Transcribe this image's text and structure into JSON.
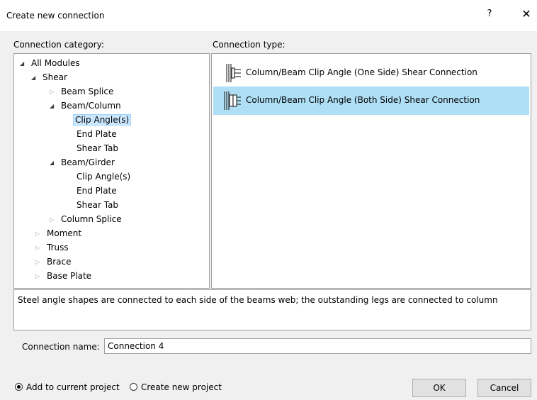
{
  "window": {
    "title": "Create new connection",
    "help_label": "?",
    "close_label": "✕"
  },
  "category": {
    "label": "Connection category:",
    "tree": [
      {
        "label": "All Modules",
        "caret": "◢",
        "expanded": true
      },
      {
        "label": "Shear",
        "caret": "◢",
        "expanded": true
      },
      {
        "label": "Beam Splice",
        "caret": "▷",
        "expanded": false
      },
      {
        "label": "Beam/Column",
        "caret": "◢",
        "expanded": true
      },
      {
        "label": "Clip Angle(s)",
        "caret": "",
        "selected": true
      },
      {
        "label": "End Plate",
        "caret": ""
      },
      {
        "label": "Shear Tab",
        "caret": ""
      },
      {
        "label": "Beam/Girder",
        "caret": "◢",
        "expanded": true
      },
      {
        "label": "Clip Angle(s)",
        "caret": ""
      },
      {
        "label": "End Plate",
        "caret": ""
      },
      {
        "label": "Shear Tab",
        "caret": ""
      },
      {
        "label": "Column Splice",
        "caret": "▷",
        "expanded": false
      },
      {
        "label": "Moment",
        "caret": "▷",
        "expanded": false
      },
      {
        "label": "Truss",
        "caret": "▷",
        "expanded": false
      },
      {
        "label": "Brace",
        "caret": "▷",
        "expanded": false
      },
      {
        "label": "Base Plate",
        "caret": "▷",
        "expanded": false
      }
    ]
  },
  "type": {
    "label": "Connection type:",
    "items": [
      {
        "label": "Column/Beam Clip Angle (One Side) Shear Connection",
        "icon": "one-side-clip-angle-icon",
        "selected": false
      },
      {
        "label": "Column/Beam Clip Angle (Both Side) Shear Connection",
        "icon": "both-side-clip-angle-icon",
        "selected": true
      }
    ]
  },
  "description": "Steel angle shapes are connected to each side of the beams web; the outstanding legs are connected to column",
  "name": {
    "label": "Connection name:",
    "value": "Connection 4"
  },
  "options": {
    "add_current": "Add to current project",
    "create_new": "Create new project",
    "selected": "add_current"
  },
  "buttons": {
    "ok": "OK",
    "cancel": "Cancel"
  },
  "colors": {
    "selected_type_bg": "#aedff5",
    "selected_tree_bg": "#cce8ff"
  }
}
